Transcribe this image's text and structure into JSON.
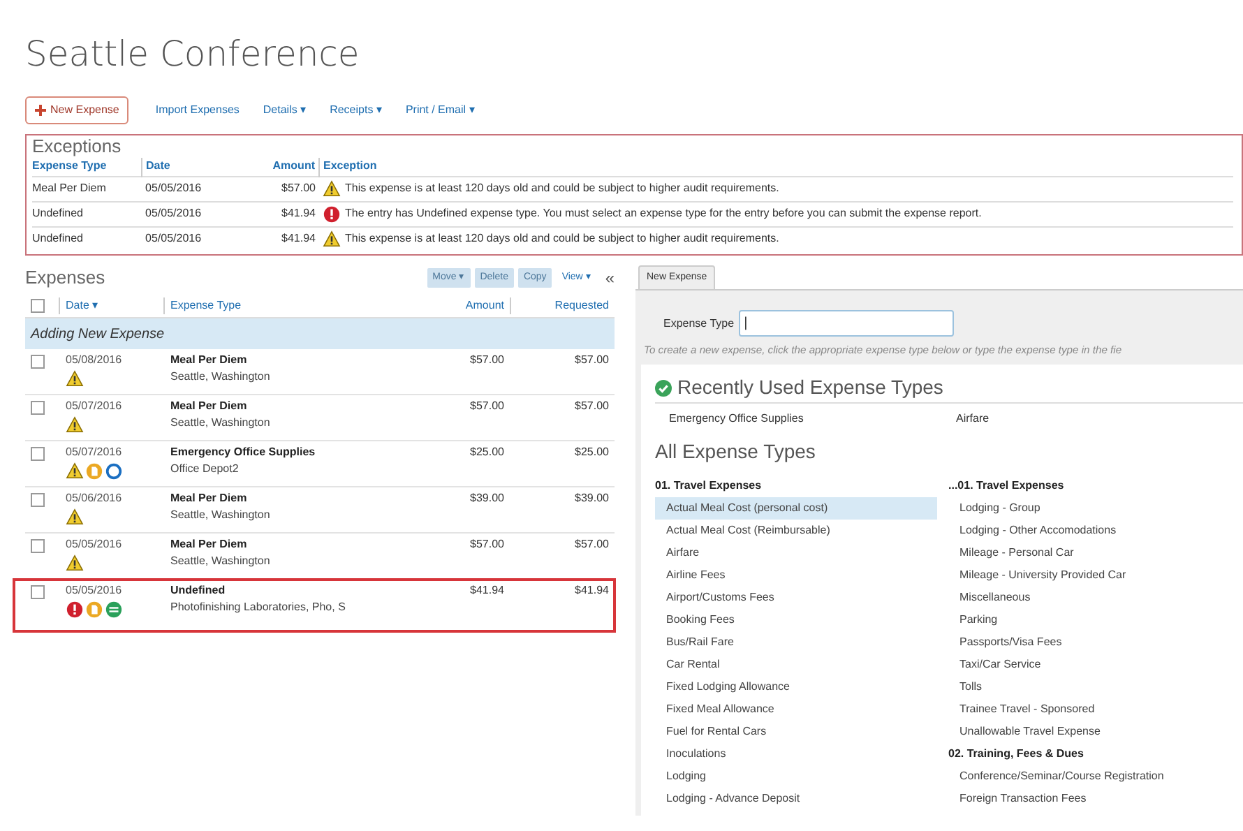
{
  "report_title": "Seattle Conference",
  "toolbar": [
    {
      "label": "New Expense",
      "kind": "primary"
    },
    {
      "label": "Import Expenses",
      "kind": "link"
    },
    {
      "label": "Details ▾",
      "kind": "link"
    },
    {
      "label": "Receipts ▾",
      "kind": "link"
    },
    {
      "label": "Print / Email ▾",
      "kind": "link"
    }
  ],
  "exceptions": {
    "title": "Exceptions",
    "columns": [
      "Expense Type",
      "Date",
      "Amount",
      "Exception"
    ],
    "rows": [
      {
        "expense_type": "Meal Per Diem",
        "date": "05/05/2016",
        "amount": "$57.00",
        "kind": "warning",
        "message": "This expense is at least 120 days old and could be subject to higher audit requirements."
      },
      {
        "expense_type": "Undefined",
        "date": "05/05/2016",
        "amount": "$41.94",
        "kind": "error",
        "message": "The entry has Undefined expense type. You must select an expense type for the entry before you can submit the expense report."
      },
      {
        "expense_type": "Undefined",
        "date": "05/05/2016",
        "amount": "$41.94",
        "kind": "warning",
        "message": "This expense is at least 120 days old and could be subject to higher audit requirements."
      }
    ]
  },
  "expenses": {
    "title": "Expenses",
    "actions": [
      {
        "label": "Move ▾",
        "disabled": true
      },
      {
        "label": "Delete",
        "disabled": true
      },
      {
        "label": "Copy",
        "disabled": true
      },
      {
        "label": "View ▾",
        "disabled": false
      }
    ],
    "collapse": "«",
    "columns": [
      "Date ▾",
      "Expense Type",
      "Amount",
      "Requested"
    ],
    "select_all_checked": false,
    "adding_banner": "Adding New Expense",
    "rows": [
      {
        "date": "05/08/2016",
        "expense_type": "Meal Per Diem",
        "detail": "Seattle, Washington",
        "amount": "$57.00",
        "requested": "$57.00",
        "flags": [
          {
            "kind": "warning"
          }
        ],
        "checked": false,
        "outlined": false
      },
      {
        "date": "05/07/2016",
        "expense_type": "Meal Per Diem",
        "detail": "Seattle, Washington",
        "amount": "$57.00",
        "requested": "$57.00",
        "flags": [
          {
            "kind": "warning"
          }
        ],
        "checked": false,
        "outlined": false
      },
      {
        "date": "05/07/2016",
        "expense_type": "Emergency Office Supplies",
        "detail": "Office Depot2",
        "amount": "$25.00",
        "requested": "$25.00",
        "flags": [
          {
            "kind": "warning"
          },
          {
            "kind": "receipt"
          },
          {
            "kind": "comment"
          }
        ],
        "checked": false,
        "outlined": false
      },
      {
        "date": "05/06/2016",
        "expense_type": "Meal Per Diem",
        "detail": "Seattle, Washington",
        "amount": "$39.00",
        "requested": "$39.00",
        "flags": [
          {
            "kind": "warning"
          }
        ],
        "checked": false,
        "outlined": false
      },
      {
        "date": "05/05/2016",
        "expense_type": "Meal Per Diem",
        "detail": "Seattle, Washington",
        "amount": "$57.00",
        "requested": "$57.00",
        "flags": [
          {
            "kind": "warning"
          }
        ],
        "checked": false,
        "outlined": false
      },
      {
        "date": "05/05/2016",
        "expense_type": "Undefined",
        "detail": "Photofinishing Laboratories, Pho, S",
        "amount": "$41.94",
        "requested": "$41.94",
        "flags": [
          {
            "kind": "error"
          },
          {
            "kind": "receipt"
          },
          {
            "kind": "itemized"
          }
        ],
        "checked": false,
        "outlined": true
      }
    ]
  },
  "new_expense": {
    "tab": "New Expense",
    "field_label": "Expense Type",
    "field_value": "|",
    "hint": "To create a new expense, click the appropriate expense type below or type the expense type in the fie",
    "recent_title": "Recently Used Expense Types",
    "recent": [
      "Emergency Office Supplies",
      "Airfare"
    ],
    "all_title": "All Expense Types",
    "columns": [
      [
        {
          "kind": "header",
          "label": "01. Travel Expenses"
        },
        {
          "kind": "item",
          "label": "Actual Meal Cost (personal cost)",
          "selected": true
        },
        {
          "kind": "item",
          "label": "Actual Meal Cost (Reimbursable)",
          "selected": false
        },
        {
          "kind": "item",
          "label": "Airfare",
          "selected": false
        },
        {
          "kind": "item",
          "label": "Airline Fees",
          "selected": false
        },
        {
          "kind": "item",
          "label": "Airport/Customs Fees",
          "selected": false
        },
        {
          "kind": "item",
          "label": "Booking Fees",
          "selected": false
        },
        {
          "kind": "item",
          "label": "Bus/Rail Fare",
          "selected": false
        },
        {
          "kind": "item",
          "label": "Car Rental",
          "selected": false
        },
        {
          "kind": "item",
          "label": "Fixed Lodging Allowance",
          "selected": false
        },
        {
          "kind": "item",
          "label": "Fixed Meal Allowance",
          "selected": false
        },
        {
          "kind": "item",
          "label": "Fuel for Rental Cars",
          "selected": false
        },
        {
          "kind": "item",
          "label": "Inoculations",
          "selected": false
        },
        {
          "kind": "item",
          "label": "Lodging",
          "selected": false
        },
        {
          "kind": "item",
          "label": "Lodging - Advance Deposit",
          "selected": false
        }
      ],
      [
        {
          "kind": "header",
          "label": "...01. Travel Expenses"
        },
        {
          "kind": "item",
          "label": "Lodging - Group",
          "selected": false
        },
        {
          "kind": "item",
          "label": "Lodging - Other Accomodations",
          "selected": false
        },
        {
          "kind": "item",
          "label": "Mileage - Personal Car",
          "selected": false
        },
        {
          "kind": "item",
          "label": "Mileage - University Provided Car",
          "selected": false
        },
        {
          "kind": "item",
          "label": "Miscellaneous",
          "selected": false
        },
        {
          "kind": "item",
          "label": "Parking",
          "selected": false
        },
        {
          "kind": "item",
          "label": "Passports/Visa Fees",
          "selected": false
        },
        {
          "kind": "item",
          "label": "Taxi/Car Service",
          "selected": false
        },
        {
          "kind": "item",
          "label": "Tolls",
          "selected": false
        },
        {
          "kind": "item",
          "label": "Trainee Travel - Sponsored",
          "selected": false
        },
        {
          "kind": "item",
          "label": "Unallowable Travel Expense",
          "selected": false
        },
        {
          "kind": "header",
          "label": "02. Training, Fees & Dues"
        },
        {
          "kind": "item",
          "label": "Conference/Seminar/Course Registration",
          "selected": false
        },
        {
          "kind": "item",
          "label": "Foreign Transaction Fees",
          "selected": false
        }
      ]
    ]
  }
}
